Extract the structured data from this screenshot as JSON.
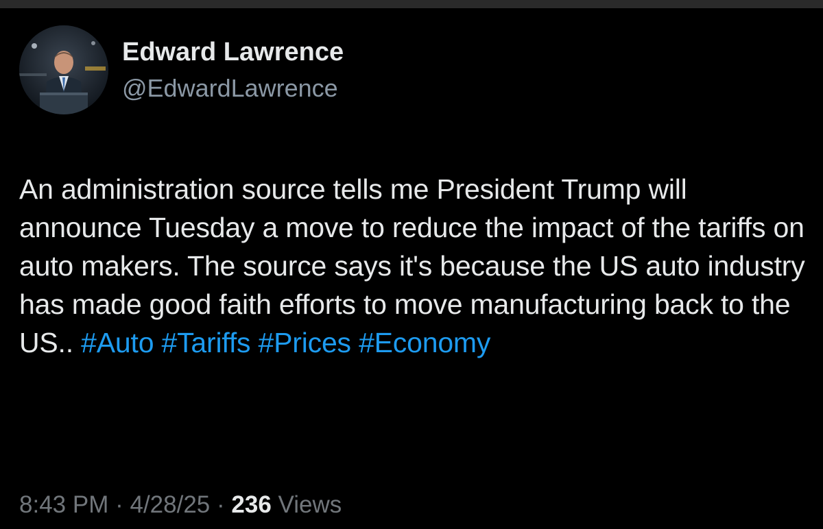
{
  "author": {
    "display_name": "Edward Lawrence",
    "handle": "@EdwardLawrence"
  },
  "tweet": {
    "text_before_hashtags": "An administration source tells me President Trump will announce Tuesday a move to reduce the impact of the tariffs on auto makers. The source says it's because the US auto industry has made good faith efforts to move manufacturing back to the US..",
    "hashtags": [
      "#Auto",
      "#Tariffs",
      "#Prices",
      "#Economy"
    ]
  },
  "meta": {
    "time": "8:43 PM",
    "separator": "·",
    "date": "4/28/25",
    "views_count": "236",
    "views_label": "Views"
  },
  "colors": {
    "background": "#000000",
    "text_primary": "#e7e9ea",
    "text_secondary": "#71767b",
    "link": "#1d9bf0"
  },
  "icons": {
    "avatar": "profile-photo-man-at-podium"
  }
}
